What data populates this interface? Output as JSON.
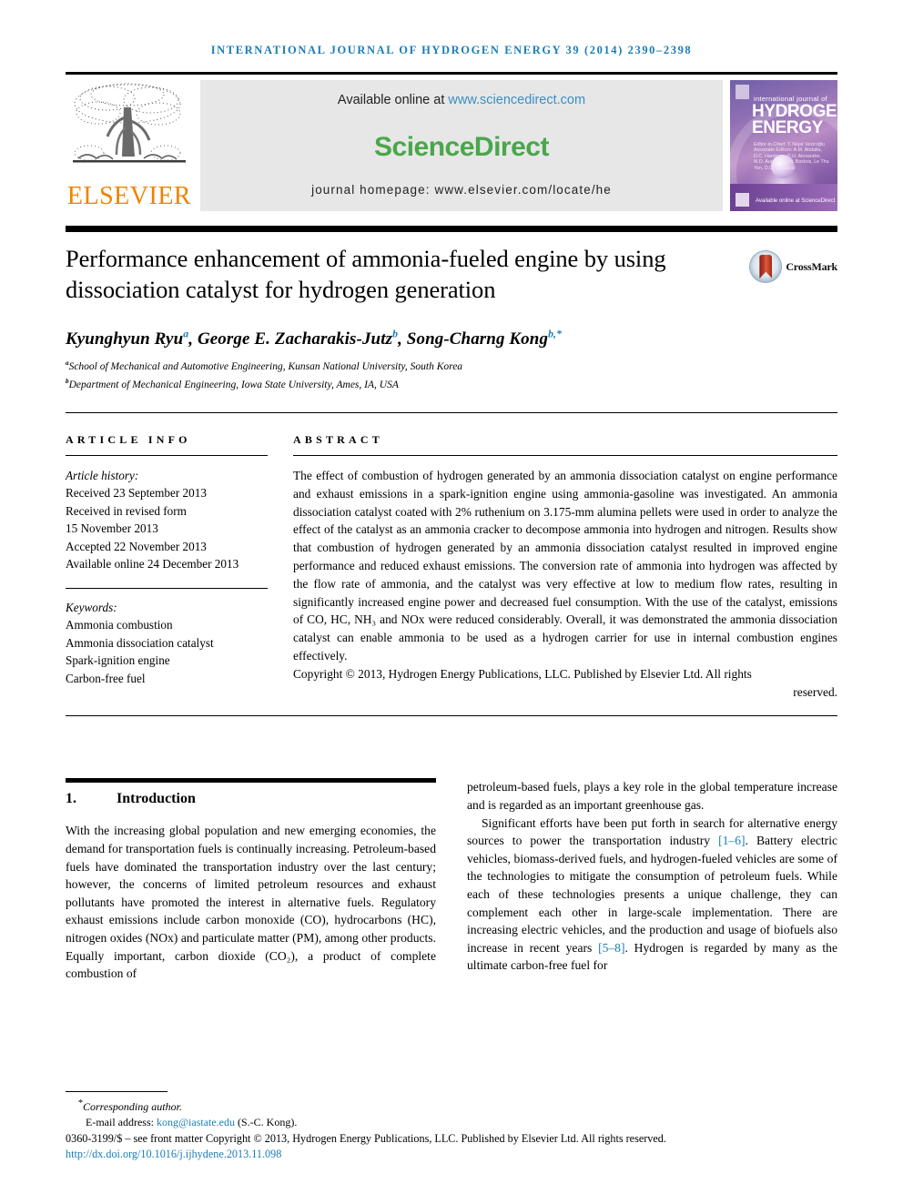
{
  "running_head": "INTERNATIONAL JOURNAL OF HYDROGEN ENERGY 39 (2014) 2390–2398",
  "masthead": {
    "publisher_word": "ELSEVIER",
    "available_prefix": "Available online at ",
    "available_url": "www.sciencedirect.com",
    "sciencedirect_logo": "ScienceDirect",
    "homepage_line": "journal homepage: www.elsevier.com/locate/he",
    "cover": {
      "small_title": "international journal of",
      "big_title_line1": "HYDROGEN",
      "big_title_line2": "ENERGY",
      "editors": "Editor-in-Chief: T. Nejat Veziroğlu   Associate Editors: A.M. Abdalla, D.C. Hardman, D.H. Alexandre, M.D. Aurichio, J.M. Bockris, Le Thu Yen, D.C. Srivastav",
      "sciencedirect_mark": "Available online at\nScienceDirect"
    }
  },
  "article": {
    "title": "Performance enhancement of ammonia-fueled engine by using dissociation catalyst for hydrogen generation",
    "crossmark_label": "CrossMark",
    "authors": [
      {
        "name": "Kyunghyun Ryu",
        "sup": "a",
        "sep": ", "
      },
      {
        "name": "George E. Zacharakis-Jutz",
        "sup": "b",
        "sep": ", "
      },
      {
        "name": "Song-Charng Kong",
        "sup": "b,*",
        "sep": ""
      }
    ],
    "affiliations": [
      {
        "sup": "a",
        "text": "School of Mechanical and Automotive Engineering, Kunsan National University, South Korea"
      },
      {
        "sup": "b",
        "text": "Department of Mechanical Engineering, Iowa State University, Ames, IA, USA"
      }
    ]
  },
  "article_info": {
    "label": "ARTICLE INFO",
    "history_label": "Article history:",
    "history": [
      "Received 23 September 2013",
      "Received in revised form",
      "15 November 2013",
      "Accepted 22 November 2013",
      "Available online 24 December 2013"
    ],
    "keywords_label": "Keywords:",
    "keywords": [
      "Ammonia combustion",
      "Ammonia dissociation catalyst",
      "Spark-ignition engine",
      "Carbon-free fuel"
    ]
  },
  "abstract": {
    "label": "ABSTRACT",
    "text": "The effect of combustion of hydrogen generated by an ammonia dissociation catalyst on engine performance and exhaust emissions in a spark-ignition engine using ammonia-gasoline was investigated. An ammonia dissociation catalyst coated with 2% ruthenium on 3.175-mm alumina pellets were used in order to analyze the effect of the catalyst as an ammonia cracker to decompose ammonia into hydrogen and nitrogen. Results show that combustion of hydrogen generated by an ammonia dissociation catalyst resulted in improved engine performance and reduced exhaust emissions. The conversion rate of ammonia into hydrogen was affected by the flow rate of ammonia, and the catalyst was very effective at low to medium flow rates, resulting in significantly increased engine power and decreased fuel consumption. With the use of the catalyst, emissions of CO, HC, NH₃ and NOx were reduced considerably. Overall, it was demonstrated the ammonia dissociation catalyst can enable ammonia to be used as a hydrogen carrier for use in internal combustion engines effectively.",
    "copyright_main": "Copyright © 2013, Hydrogen Energy Publications, LLC. Published by Elsevier Ltd. All rights",
    "copyright_tail": "reserved."
  },
  "body": {
    "section_number": "1.",
    "section_title": "Introduction",
    "col1_paragraph": "With the increasing global population and new emerging economies, the demand for transportation fuels is continually increasing. Petroleum-based fuels have dominated the transportation industry over the last century; however, the concerns of limited petroleum resources and exhaust pollutants have promoted the interest in alternative fuels. Regulatory exhaust emissions include carbon monoxide (CO), hydrocarbons (HC), nitrogen oxides (NOx) and particulate matter (PM), among other products. Equally important, carbon dioxide (CO₂), a product of complete combustion of",
    "col2_paragraph_1": "petroleum-based fuels, plays a key role in the global temperature increase and is regarded as an important greenhouse gas.",
    "col2_paragraph_2_a": "Significant efforts have been put forth in search for alternative energy sources to power the transportation industry ",
    "col2_ref_1": "[1–6]",
    "col2_paragraph_2_b": ". Battery electric vehicles, biomass-derived fuels, and hydrogen-fueled vehicles are some of the technologies to mitigate the consumption of petroleum fuels. While each of these technologies presents a unique challenge, they can complement each other in large-scale implementation. There are increasing electric vehicles, and the production and usage of biofuels also increase in recent years ",
    "col2_ref_2": "[5–8]",
    "col2_paragraph_2_c": ". Hydrogen is regarded by many as the ultimate carbon-free fuel for"
  },
  "footer": {
    "corresponding_sup": "*",
    "corresponding": "Corresponding author.",
    "email_label": "E-mail address: ",
    "email": "kong@iastate.edu",
    "email_suffix": " (S.-C. Kong).",
    "issn_line": "0360-3199/$ – see front matter Copyright © 2013, Hydrogen Energy Publications, LLC. Published by Elsevier Ltd. All rights reserved.",
    "doi": "http://dx.doi.org/10.1016/j.ijhydene.2013.11.098"
  },
  "colors": {
    "link": "#1a7db6",
    "elsevier_orange": "#ef8200",
    "sciencedirect_green": "#4aa74a",
    "sd_band": "#e7e7e7"
  }
}
